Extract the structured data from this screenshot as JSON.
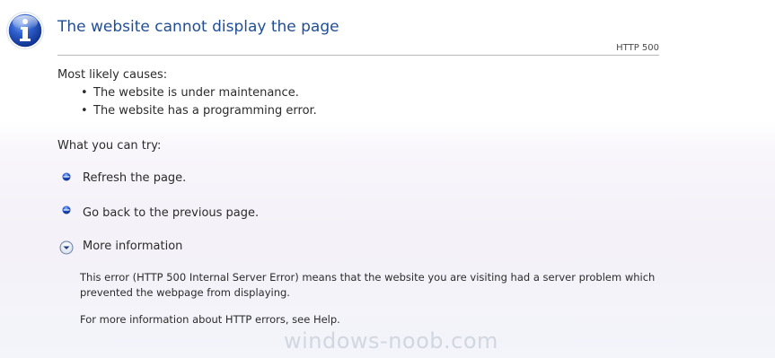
{
  "header": {
    "title": "The website cannot display the page",
    "code": "HTTP 500"
  },
  "causes": {
    "label": "Most likely causes:",
    "items": [
      "The website is under maintenance.",
      "The website has a programming error."
    ]
  },
  "try": {
    "label": "What you can try:",
    "refresh": "Refresh the page.",
    "back": "Go back to the previous page.",
    "more": "More information"
  },
  "more_info": {
    "paragraph1": "This error (HTTP 500 Internal Server Error) means that the website you are visiting had a server problem which prevented the webpage from displaying.",
    "paragraph2": "For more information about HTTP errors, see Help."
  },
  "watermark": "windows-noob.com",
  "icons": {
    "header": "info-icon",
    "actions": "blue-bullet-icon",
    "expand": "chevron-down-icon"
  },
  "colors": {
    "title": "#1f4e96",
    "icon_blue": "#1a4fb8"
  }
}
